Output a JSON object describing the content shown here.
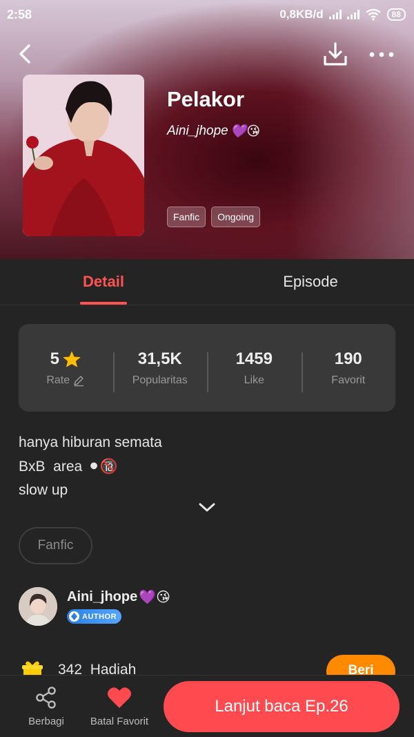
{
  "status_bar": {
    "time": "2:58",
    "network_speed": "0,8KB/d",
    "battery": "88"
  },
  "book": {
    "title": "Pelakor",
    "author": "Aini_jhope",
    "author_emoji": "💜😘",
    "tags": [
      "Fanfic",
      "Ongoing"
    ]
  },
  "tabs": {
    "detail": "Detail",
    "episode": "Episode",
    "active": "Detail"
  },
  "stats": {
    "rate_value": "5",
    "rate_label": "Rate",
    "popularity_value": "31,5K",
    "popularity_label": "Popularitas",
    "like_value": "1459",
    "like_label": "Like",
    "favorite_value": "190",
    "favorite_label": "Favorit"
  },
  "description": {
    "line1": "hanya hiburan semata",
    "line2": "BxB  area",
    "line2_emoji": "⚫🔞",
    "line3": "slow up"
  },
  "genre_chip": "Fanfic",
  "author_section": {
    "name": "Aini_jhope",
    "name_emoji": "💜😘",
    "badge": "AUTHOR"
  },
  "gifts": {
    "count_text": "342  Hadiah",
    "button_label": "Beri"
  },
  "bottom_bar": {
    "share_label": "Berbagi",
    "unfavorite_label": "Batal Favorit",
    "read_button": "Lanjut baca Ep.26"
  },
  "colors": {
    "accent": "#ff5353",
    "read_button": "#ff4b4f",
    "gift_button": "#ff8a00",
    "background": "#242424",
    "card": "#393939"
  },
  "icons": {
    "back": "chevron-left-icon",
    "download": "download-icon",
    "more": "more-horizontal-icon",
    "star": "star-icon",
    "edit": "pencil-icon",
    "expand": "chevron-down-icon",
    "share": "share-icon",
    "heart": "heart-icon",
    "gift": "gift-icon"
  }
}
